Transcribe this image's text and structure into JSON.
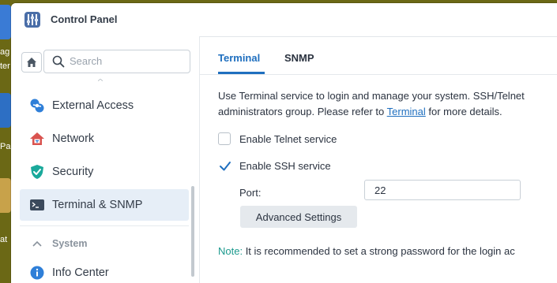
{
  "desktop": {
    "label_fragments": [
      "ag",
      "ter",
      "Pa",
      "at"
    ]
  },
  "window": {
    "title": "Control Panel"
  },
  "sidebar": {
    "search_placeholder": "Search",
    "items": [
      {
        "label": "External Access",
        "icon": "external-access-icon",
        "color": "#2f7fd8"
      },
      {
        "label": "Network",
        "icon": "network-house-icon",
        "color": "#d9534f"
      },
      {
        "label": "Security",
        "icon": "security-shield-icon",
        "color": "#1aa99b"
      },
      {
        "label": "Terminal & SNMP",
        "icon": "terminal-icon",
        "color": "#3b4a5c",
        "active": true
      }
    ],
    "section": {
      "label": "System",
      "icon": "chevron-up-icon"
    },
    "items_after": [
      {
        "label": "Info Center",
        "icon": "info-icon",
        "color": "#2f7fd8"
      }
    ]
  },
  "tabs": [
    {
      "label": "Terminal",
      "active": true
    },
    {
      "label": "SNMP",
      "active": false
    }
  ],
  "terminal": {
    "desc_line1": "Use Terminal service to login and manage your system. SSH/Telnet",
    "desc_line2_pre": "administrators group. Please refer to ",
    "desc_link": "Terminal",
    "desc_line2_post": " for more details.",
    "telnet_label": "Enable Telnet service",
    "telnet_checked": false,
    "ssh_label": "Enable SSH service",
    "ssh_checked": true,
    "port_label": "Port:",
    "port_value": "22",
    "advanced_button": "Advanced Settings",
    "note_label": "Note:",
    "note_text": " It is recommended to set a strong password for the login ac"
  },
  "colors": {
    "accent": "#1f6fbf",
    "active_row": "#e6eef7",
    "note": "#1c9a8e"
  }
}
